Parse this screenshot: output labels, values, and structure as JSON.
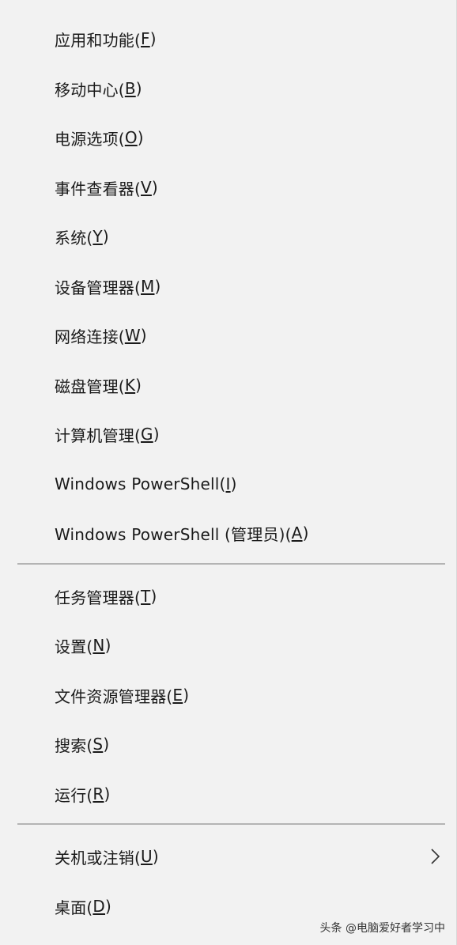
{
  "menu": {
    "group1": [
      {
        "label": "应用和功能(",
        "key": "F",
        "tail": ")"
      },
      {
        "label": "移动中心(",
        "key": "B",
        "tail": ")"
      },
      {
        "label": "电源选项(",
        "key": "O",
        "tail": ")"
      },
      {
        "label": "事件查看器(",
        "key": "V",
        "tail": ")"
      },
      {
        "label": "系统(",
        "key": "Y",
        "tail": ")"
      },
      {
        "label": "设备管理器(",
        "key": "M",
        "tail": ")"
      },
      {
        "label": "网络连接(",
        "key": "W",
        "tail": ")"
      },
      {
        "label": "磁盘管理(",
        "key": "K",
        "tail": ")"
      },
      {
        "label": "计算机管理(",
        "key": "G",
        "tail": ")"
      },
      {
        "label": "Windows PowerShell(",
        "key": "I",
        "tail": ")"
      },
      {
        "label": "Windows PowerShell (管理员)(",
        "key": "A",
        "tail": ")"
      }
    ],
    "group2": [
      {
        "label": "任务管理器(",
        "key": "T",
        "tail": ")"
      },
      {
        "label": "设置(",
        "key": "N",
        "tail": ")"
      },
      {
        "label": "文件资源管理器(",
        "key": "E",
        "tail": ")"
      },
      {
        "label": "搜索(",
        "key": "S",
        "tail": ")"
      },
      {
        "label": "运行(",
        "key": "R",
        "tail": ")"
      }
    ],
    "group3": [
      {
        "label": "关机或注销(",
        "key": "U",
        "tail": ")",
        "submenu_icon": "chevron-right-icon"
      },
      {
        "label": "桌面(",
        "key": "D",
        "tail": ")"
      }
    ]
  },
  "watermark": "头条 @电脑爱好者学习中",
  "colors": {
    "background": "#f2f2f2",
    "text": "#1a1a1a",
    "separator": "#b4b4b4"
  }
}
